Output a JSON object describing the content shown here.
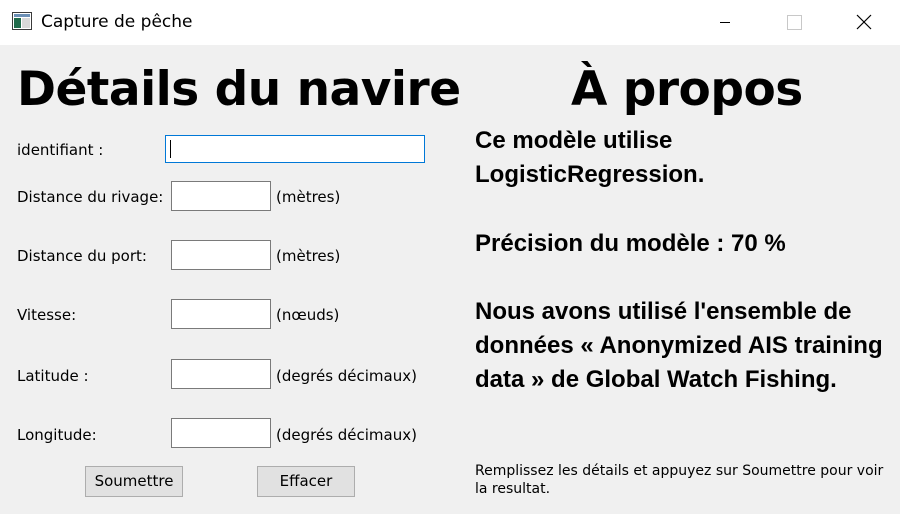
{
  "window": {
    "title": "Capture de pêche",
    "icon": "app-window-icon",
    "controls": [
      "minimize-icon",
      "maximize-icon",
      "close-icon"
    ]
  },
  "left": {
    "heading": "Détails du navire",
    "fields": [
      {
        "label": "identifiant :",
        "value": "",
        "placeholder": "",
        "unit": ""
      },
      {
        "label": "Distance du rivage:",
        "value": "",
        "placeholder": "",
        "unit": "(mètres)"
      },
      {
        "label": "Distance du port:",
        "value": "",
        "placeholder": "",
        "unit": "(mètres)"
      },
      {
        "label": "Vitesse:",
        "value": "",
        "placeholder": "",
        "unit": "(nœuds)"
      },
      {
        "label": "Latitude :",
        "value": "",
        "placeholder": "",
        "unit": "(degrés décimaux)"
      },
      {
        "label": "Longitude:",
        "value": "",
        "placeholder": "",
        "unit": "(degrés décimaux)"
      }
    ],
    "buttons": {
      "submit": "Soumettre",
      "clear": "Effacer"
    }
  },
  "right": {
    "heading": "À propos",
    "model_text": "Ce modèle utilise LogisticRegression.",
    "precision_text": "Précision du modèle : 70 %",
    "dataset_text": "Nous avons utilisé l'ensemble de données « Anonymized AIS training data » de Global Watch Fishing.",
    "hint": "Remplissez les détails et appuyez sur Soumettre pour voir la resultat."
  },
  "colors": {
    "window_bg": "#f0f0f0",
    "titlebar_bg": "#ffffff",
    "focus_border": "#0078d7",
    "button_bg": "#e1e1e1"
  }
}
